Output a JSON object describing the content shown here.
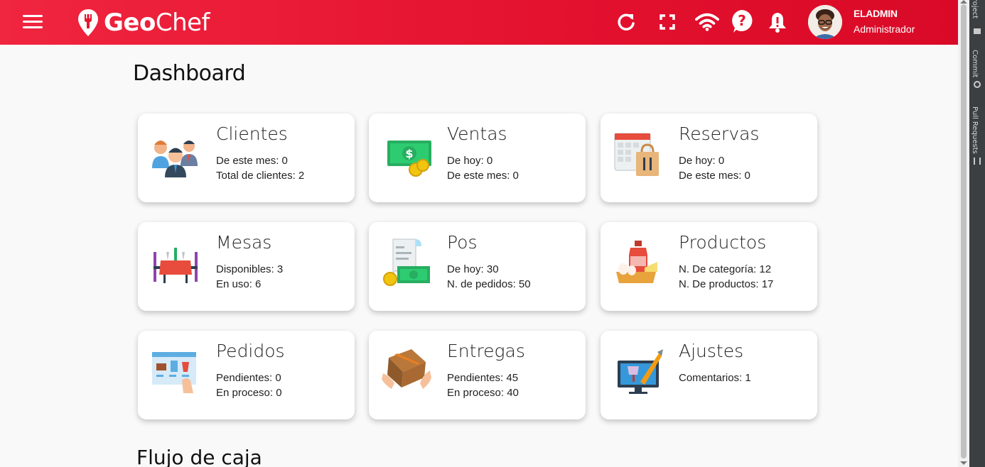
{
  "app": {
    "logo_bold": "Geo",
    "logo_light": "Chef"
  },
  "user": {
    "name": "ELADMIN",
    "role": "Administrador"
  },
  "page": {
    "title": "Dashboard",
    "next_section": "Flujo de caja"
  },
  "cards": [
    {
      "title": "Clientes",
      "l1": "De este mes: 0",
      "l2": "Total de clientes: 2",
      "icon": "clients-icon"
    },
    {
      "title": "Ventas",
      "l1": "De hoy: 0",
      "l2": "De este mes: 0",
      "icon": "money-icon"
    },
    {
      "title": "Reservas",
      "l1": "De hoy: 0",
      "l2": "De este mes: 0",
      "icon": "calendar-icon"
    },
    {
      "title": "Mesas",
      "l1": "Disponibles: 3",
      "l2": "En uso: 6",
      "icon": "table-icon"
    },
    {
      "title": "Pos",
      "l1": "De hoy: 30",
      "l2": "N. de pedidos: 50",
      "icon": "receipt-icon"
    },
    {
      "title": "Productos",
      "l1": "N. De categoría: 12",
      "l2": "N. De productos: 17",
      "icon": "products-icon"
    },
    {
      "title": "Pedidos",
      "l1": "Pendientes: 0",
      "l2": "En proceso: 0",
      "icon": "orders-icon"
    },
    {
      "title": "Entregas",
      "l1": "Pendientes: 45",
      "l2": "En proceso: 40",
      "icon": "delivery-icon"
    },
    {
      "title": "Ajustes",
      "l1": "Comentarios: 1",
      "l2": "",
      "icon": "settings-icon"
    }
  ],
  "ide_strip": {
    "project": "Project",
    "commit": "Commit",
    "pull_requests": "Pull Requests"
  }
}
